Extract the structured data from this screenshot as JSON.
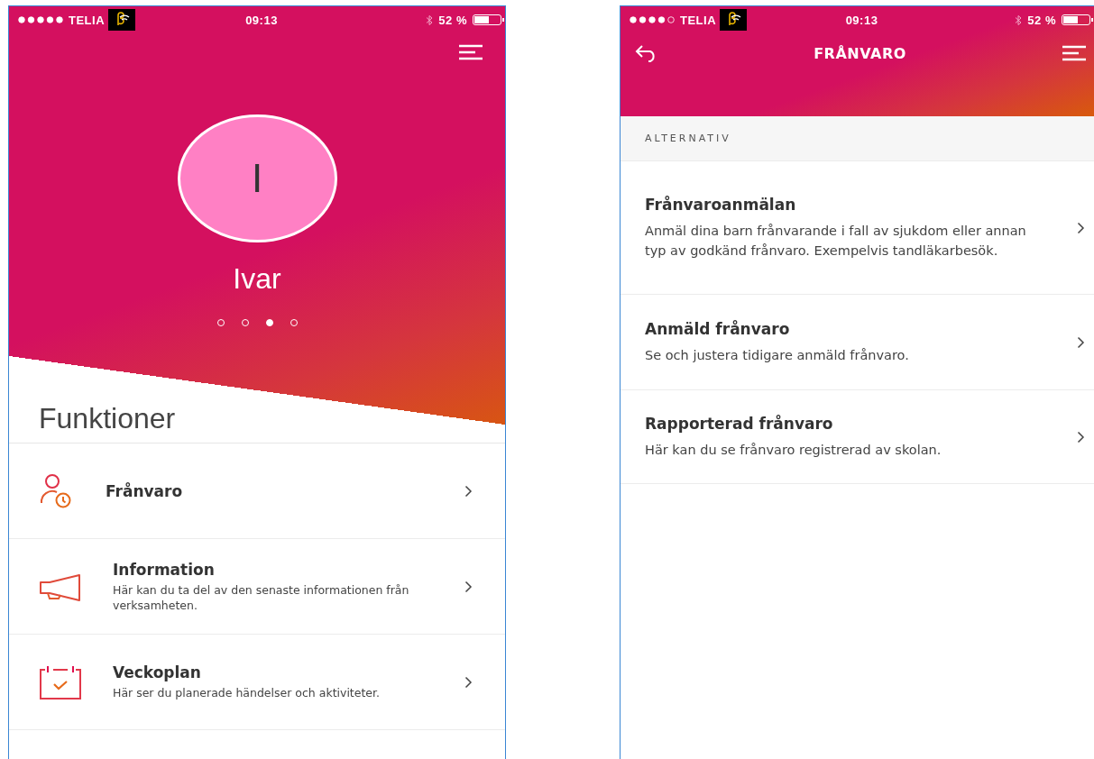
{
  "home_screen": {
    "status_bar": {
      "carrier": "TELIA",
      "time": "09:13",
      "battery": "52 %"
    },
    "profile": {
      "initial": "I",
      "name": "Ivar"
    },
    "pager": [
      {
        "selected": false
      },
      {
        "selected": false
      },
      {
        "selected": true
      },
      {
        "selected": false
      }
    ],
    "section_title": "Funktioner",
    "items": [
      {
        "title": "Frånvaro"
      },
      {
        "title": "Information",
        "description": "Här kan du ta del av den senaste informationen från verksamheten."
      },
      {
        "title": "Veckoplan",
        "description": "Här ser du planerade händelser och aktiviteter."
      }
    ]
  },
  "absence_screen": {
    "status_bar": {
      "carrier": "TELIA",
      "time": "09:13",
      "battery": "52 %"
    },
    "title": "FRÅNVARO",
    "section_label": "ALTERNATIV",
    "options": [
      {
        "title": "Frånvaroanmälan",
        "description": "Anmäl dina barn frånvarande i fall av sjukdom eller annan typ av godkänd frånvaro. Exempelvis tandläkarbesök."
      },
      {
        "title": "Anmäld frånvaro",
        "description": "Se och justera tidigare anmäld frånvaro."
      },
      {
        "title": "Rapporterad frånvaro",
        "description": "Här kan du se frånvaro registrerad av skolan."
      }
    ]
  }
}
